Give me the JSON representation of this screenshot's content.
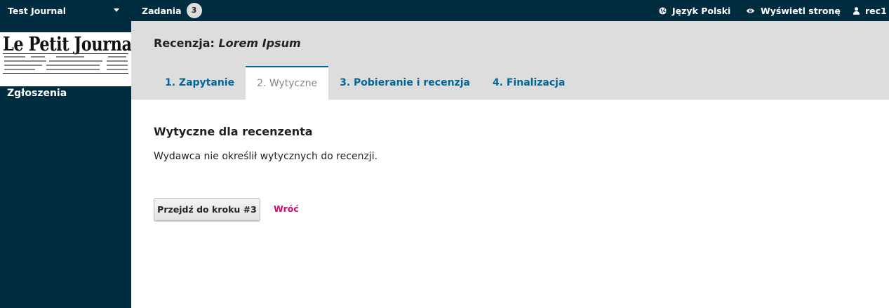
{
  "topbar": {
    "journal_name": "Test Journal",
    "tasks_label": "Zadania",
    "tasks_count": "3",
    "language_label": "Język Polski",
    "view_site_label": "Wyświetl stronę",
    "user_label": "rec1"
  },
  "sidebar": {
    "logo_text": "Le Petit Journal",
    "items": [
      {
        "label": "Zgłoszenia"
      }
    ]
  },
  "header": {
    "title_prefix": "Recenzja:",
    "title_value": "Lorem Ipsum",
    "tabs": [
      {
        "label": "1. Zapytanie",
        "active": false
      },
      {
        "label": "2. Wytyczne",
        "active": true
      },
      {
        "label": "3. Pobieranie i recenzja",
        "active": false
      },
      {
        "label": "4. Finalizacja",
        "active": false
      }
    ]
  },
  "content": {
    "section_title": "Wytyczne dla recenzenta",
    "section_text": "Wydawca nie określił wytycznych do recenzji.",
    "next_button": "Przejdź do kroku #3",
    "back_link": "Wróć"
  },
  "colors": {
    "topbar_bg": "#002c40",
    "header_bg": "#dddddd",
    "link": "#006798",
    "back_link": "#d00a6c"
  },
  "icons": {
    "language": "globe-icon",
    "view_site": "eye-icon",
    "user": "user-icon",
    "journal_menu": "caret-down-icon"
  }
}
